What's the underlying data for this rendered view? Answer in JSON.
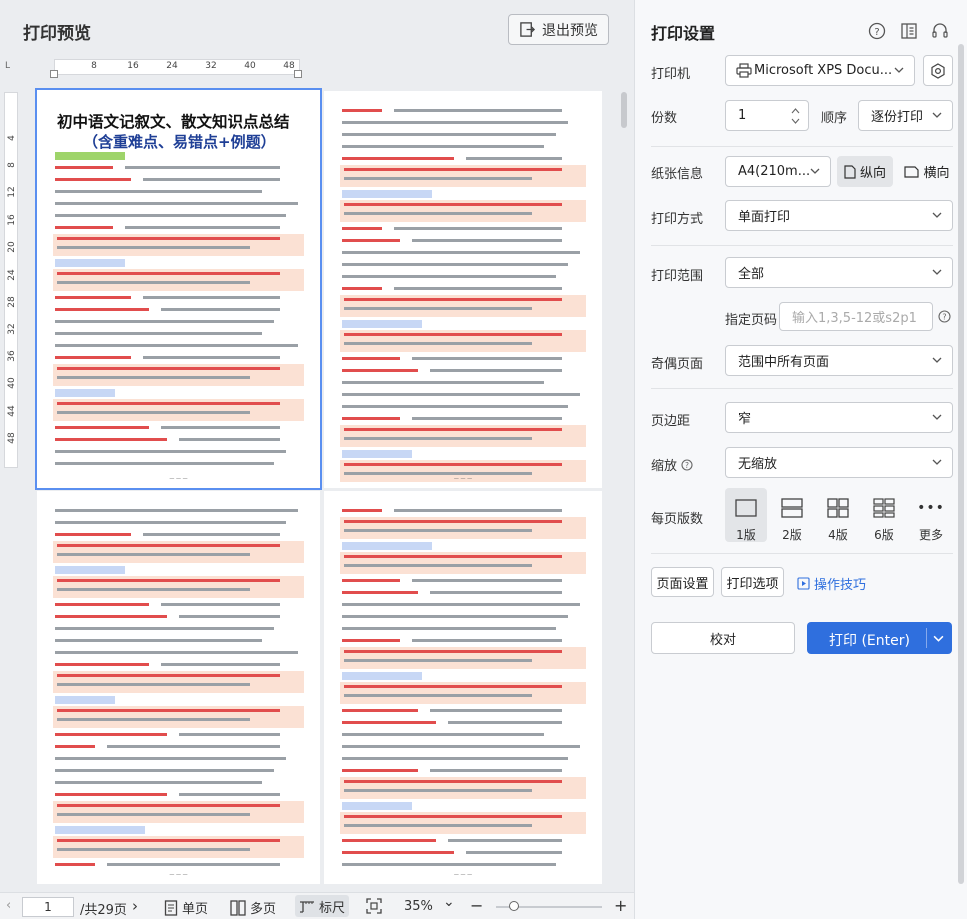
{
  "preview": {
    "title": "打印预览",
    "exit_label": "退出预览",
    "ruler_corner": "L",
    "h_ruler_ticks": [
      "8",
      "16",
      "24",
      "32",
      "40",
      "48"
    ],
    "v_ruler_ticks": [
      "4",
      "8",
      "12",
      "16",
      "20",
      "24",
      "28",
      "32",
      "36",
      "40",
      "44",
      "48"
    ],
    "page1": {
      "title_line1": "初中语文记叙文、散文知识点总结",
      "title_line2": "（含重难点、易错点+例题）"
    },
    "bottom": {
      "page_value": "1",
      "total_pages": "/共29页",
      "single_label": "单页",
      "multi_label": "多页",
      "ruler_label": "标尺",
      "zoom_value": "35%"
    }
  },
  "settings": {
    "title": "打印设置",
    "printer_label": "打印机",
    "printer_value": "Microsoft XPS Docu...",
    "copies_label": "份数",
    "copies_value": "1",
    "order_label": "顺序",
    "order_value": "逐份打印",
    "paper_label": "纸张信息",
    "paper_value": "A4(210m...",
    "portrait_label": "纵向",
    "landscape_label": "横向",
    "mode_label": "打印方式",
    "mode_value": "单面打印",
    "range_label": "打印范围",
    "range_value": "全部",
    "specify_label": "指定页码",
    "specify_placeholder": "输入1,3,5-12或s2p1",
    "odd_even_label": "奇偶页面",
    "odd_even_value": "范围中所有页面",
    "margin_label": "页边距",
    "margin_value": "窄",
    "scale_label": "缩放",
    "scale_value": "无缩放",
    "pages_per_sheet_label": "每页版数",
    "layouts": [
      "1版",
      "2版",
      "4版",
      "6版",
      "更多"
    ],
    "page_setup_label": "页面设置",
    "print_options_label": "打印选项",
    "tips_label": "操作技巧",
    "proof_label": "校对",
    "print_label": "打印 (Enter)"
  }
}
